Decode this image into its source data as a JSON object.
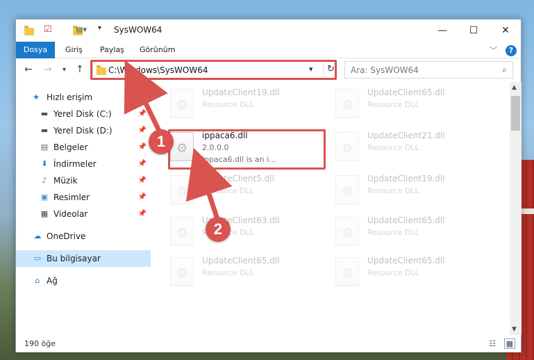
{
  "window": {
    "title": "SysWOW64",
    "minimize_icon": "minimize-icon",
    "maximize_icon": "maximize-icon",
    "close_icon": "close-icon"
  },
  "ribbon": {
    "tabs": [
      {
        "label": "Dosya",
        "active": true
      },
      {
        "label": "Giriş"
      },
      {
        "label": "Paylaş"
      },
      {
        "label": "Görünüm"
      }
    ],
    "help": "?"
  },
  "nav": {
    "address": "C:\\Windows\\SysWOW64",
    "search_placeholder": "Ara: SysWOW64"
  },
  "sidebar": {
    "items": [
      {
        "label": "Hızlı erişim",
        "icon": "star-icon"
      },
      {
        "label": "Yerel Disk (C:)",
        "icon": "drive-icon",
        "pinned": true
      },
      {
        "label": "Yerel Disk (D:)",
        "icon": "drive-icon",
        "pinned": true
      },
      {
        "label": "Belgeler",
        "icon": "documents-icon",
        "pinned": true
      },
      {
        "label": "İndirmeler",
        "icon": "download-icon",
        "pinned": true
      },
      {
        "label": "Müzik",
        "icon": "music-icon",
        "pinned": true
      },
      {
        "label": "Resimler",
        "icon": "pictures-icon",
        "pinned": true
      },
      {
        "label": "Videolar",
        "icon": "videos-icon",
        "pinned": true
      },
      {
        "label": "OneDrive",
        "icon": "cloud-icon"
      },
      {
        "label": "Bu bilgisayar",
        "icon": "computer-icon",
        "selected": true
      },
      {
        "label": "Ağ",
        "icon": "network-icon"
      }
    ]
  },
  "files": [
    {
      "name": "UpdateClient19.dll",
      "desc": "Resource DLL",
      "faded": true
    },
    {
      "name": "UpdateClient65.dll",
      "desc": "Resource DLL",
      "faded": true
    },
    {
      "name": "ippaca6.dll",
      "desc": "2.0.0.0",
      "desc2": "ippaca6.dll is an i...",
      "faded": false
    },
    {
      "name": "UpdateClient21.dll",
      "desc": "Resource DLL",
      "faded": true
    },
    {
      "name": "UpdateClient5.dll",
      "desc": "Resource DLL",
      "faded": true
    },
    {
      "name": "UpdateClient19.dll",
      "desc": "Resource DLL",
      "faded": true
    },
    {
      "name": "UpdateClient63.dll",
      "desc": "Resource DLL",
      "faded": true
    },
    {
      "name": "UpdateClient65.dll",
      "desc": "Resource DLL",
      "faded": true
    },
    {
      "name": "UpdateClient65.dll",
      "desc": "Resource DLL",
      "faded": true
    },
    {
      "name": "UpdateClient65.dll",
      "desc": "Resource DLL",
      "faded": true
    }
  ],
  "status": {
    "count": "190 öğe"
  },
  "annotations": {
    "badge1": "1",
    "badge2": "2",
    "color": "#d9534f"
  }
}
